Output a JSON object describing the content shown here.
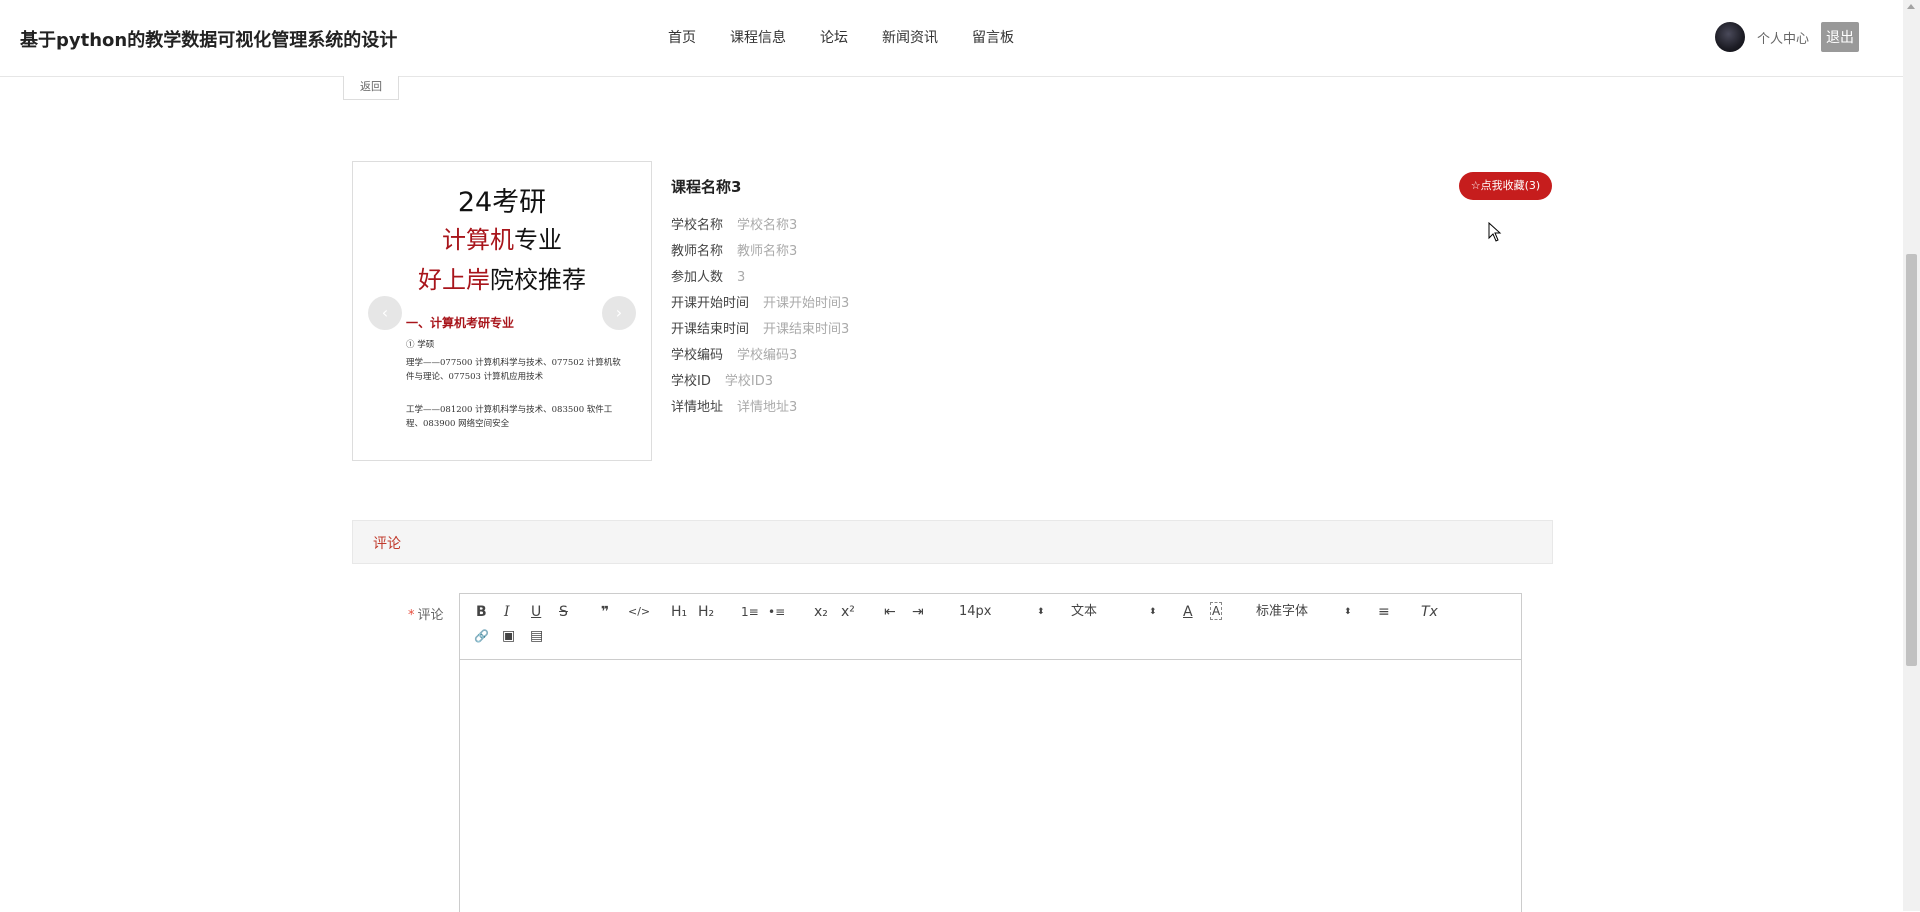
{
  "header": {
    "site_title": "基于python的教学数据可视化管理系统的设计",
    "nav": [
      "首页",
      "课程信息",
      "论坛",
      "新闻资讯",
      "留言板"
    ],
    "personal_center": "个人中心",
    "logout": "退出"
  },
  "back_label": "返回",
  "carousel": {
    "poster": {
      "line1": "24考研",
      "line2_red": "计算机",
      "line2_black": "专业",
      "line3_red": "好上岸",
      "line3_black": "院校推荐",
      "section": "一、计算机考研专业",
      "sub": "① 学硕",
      "text1": "理学——077500 计算机科学与技术、077502 计算机软件与理论、077503 计算机应用技术",
      "text2": "工学——081200 计算机科学与技术、083500 软件工程、083900 网络空间安全"
    },
    "prev_arrow": "‹",
    "next_arrow": "›"
  },
  "course": {
    "name": "课程名称3",
    "favorite_label": "☆点我收藏(3)",
    "fields": [
      {
        "label": "学校名称",
        "value": "学校名称3"
      },
      {
        "label": "教师名称",
        "value": "教师名称3"
      },
      {
        "label": "参加人数",
        "value": "3"
      },
      {
        "label": "开课开始时间",
        "value": "开课开始时间3"
      },
      {
        "label": "开课结束时间",
        "value": "开课结束时间3"
      },
      {
        "label": "学校编码",
        "value": "学校编码3"
      },
      {
        "label": "学校ID",
        "value": "学校ID3"
      },
      {
        "label": "详情地址",
        "value": "详情地址3"
      }
    ]
  },
  "comment": {
    "tab_title": "评论",
    "field_label": "评论",
    "required_mark": "*",
    "toolbar": {
      "bold": "B",
      "italic": "I",
      "underline": "U",
      "strike": "S",
      "quote": "❞",
      "code": "</>",
      "h1": "H₁",
      "h2": "H₂",
      "ordered": "1≡",
      "bullet": "•≡",
      "sub": "x₂",
      "sup": "x²",
      "outdent": "⇤",
      "indent": "⇥",
      "size_value": "14px",
      "type_value": "文本",
      "font_value": "标准字体",
      "color": "A",
      "bg": "A",
      "align": "≡",
      "clean": "Tx",
      "link": "🔗",
      "image": "▣",
      "video": "▤"
    }
  }
}
